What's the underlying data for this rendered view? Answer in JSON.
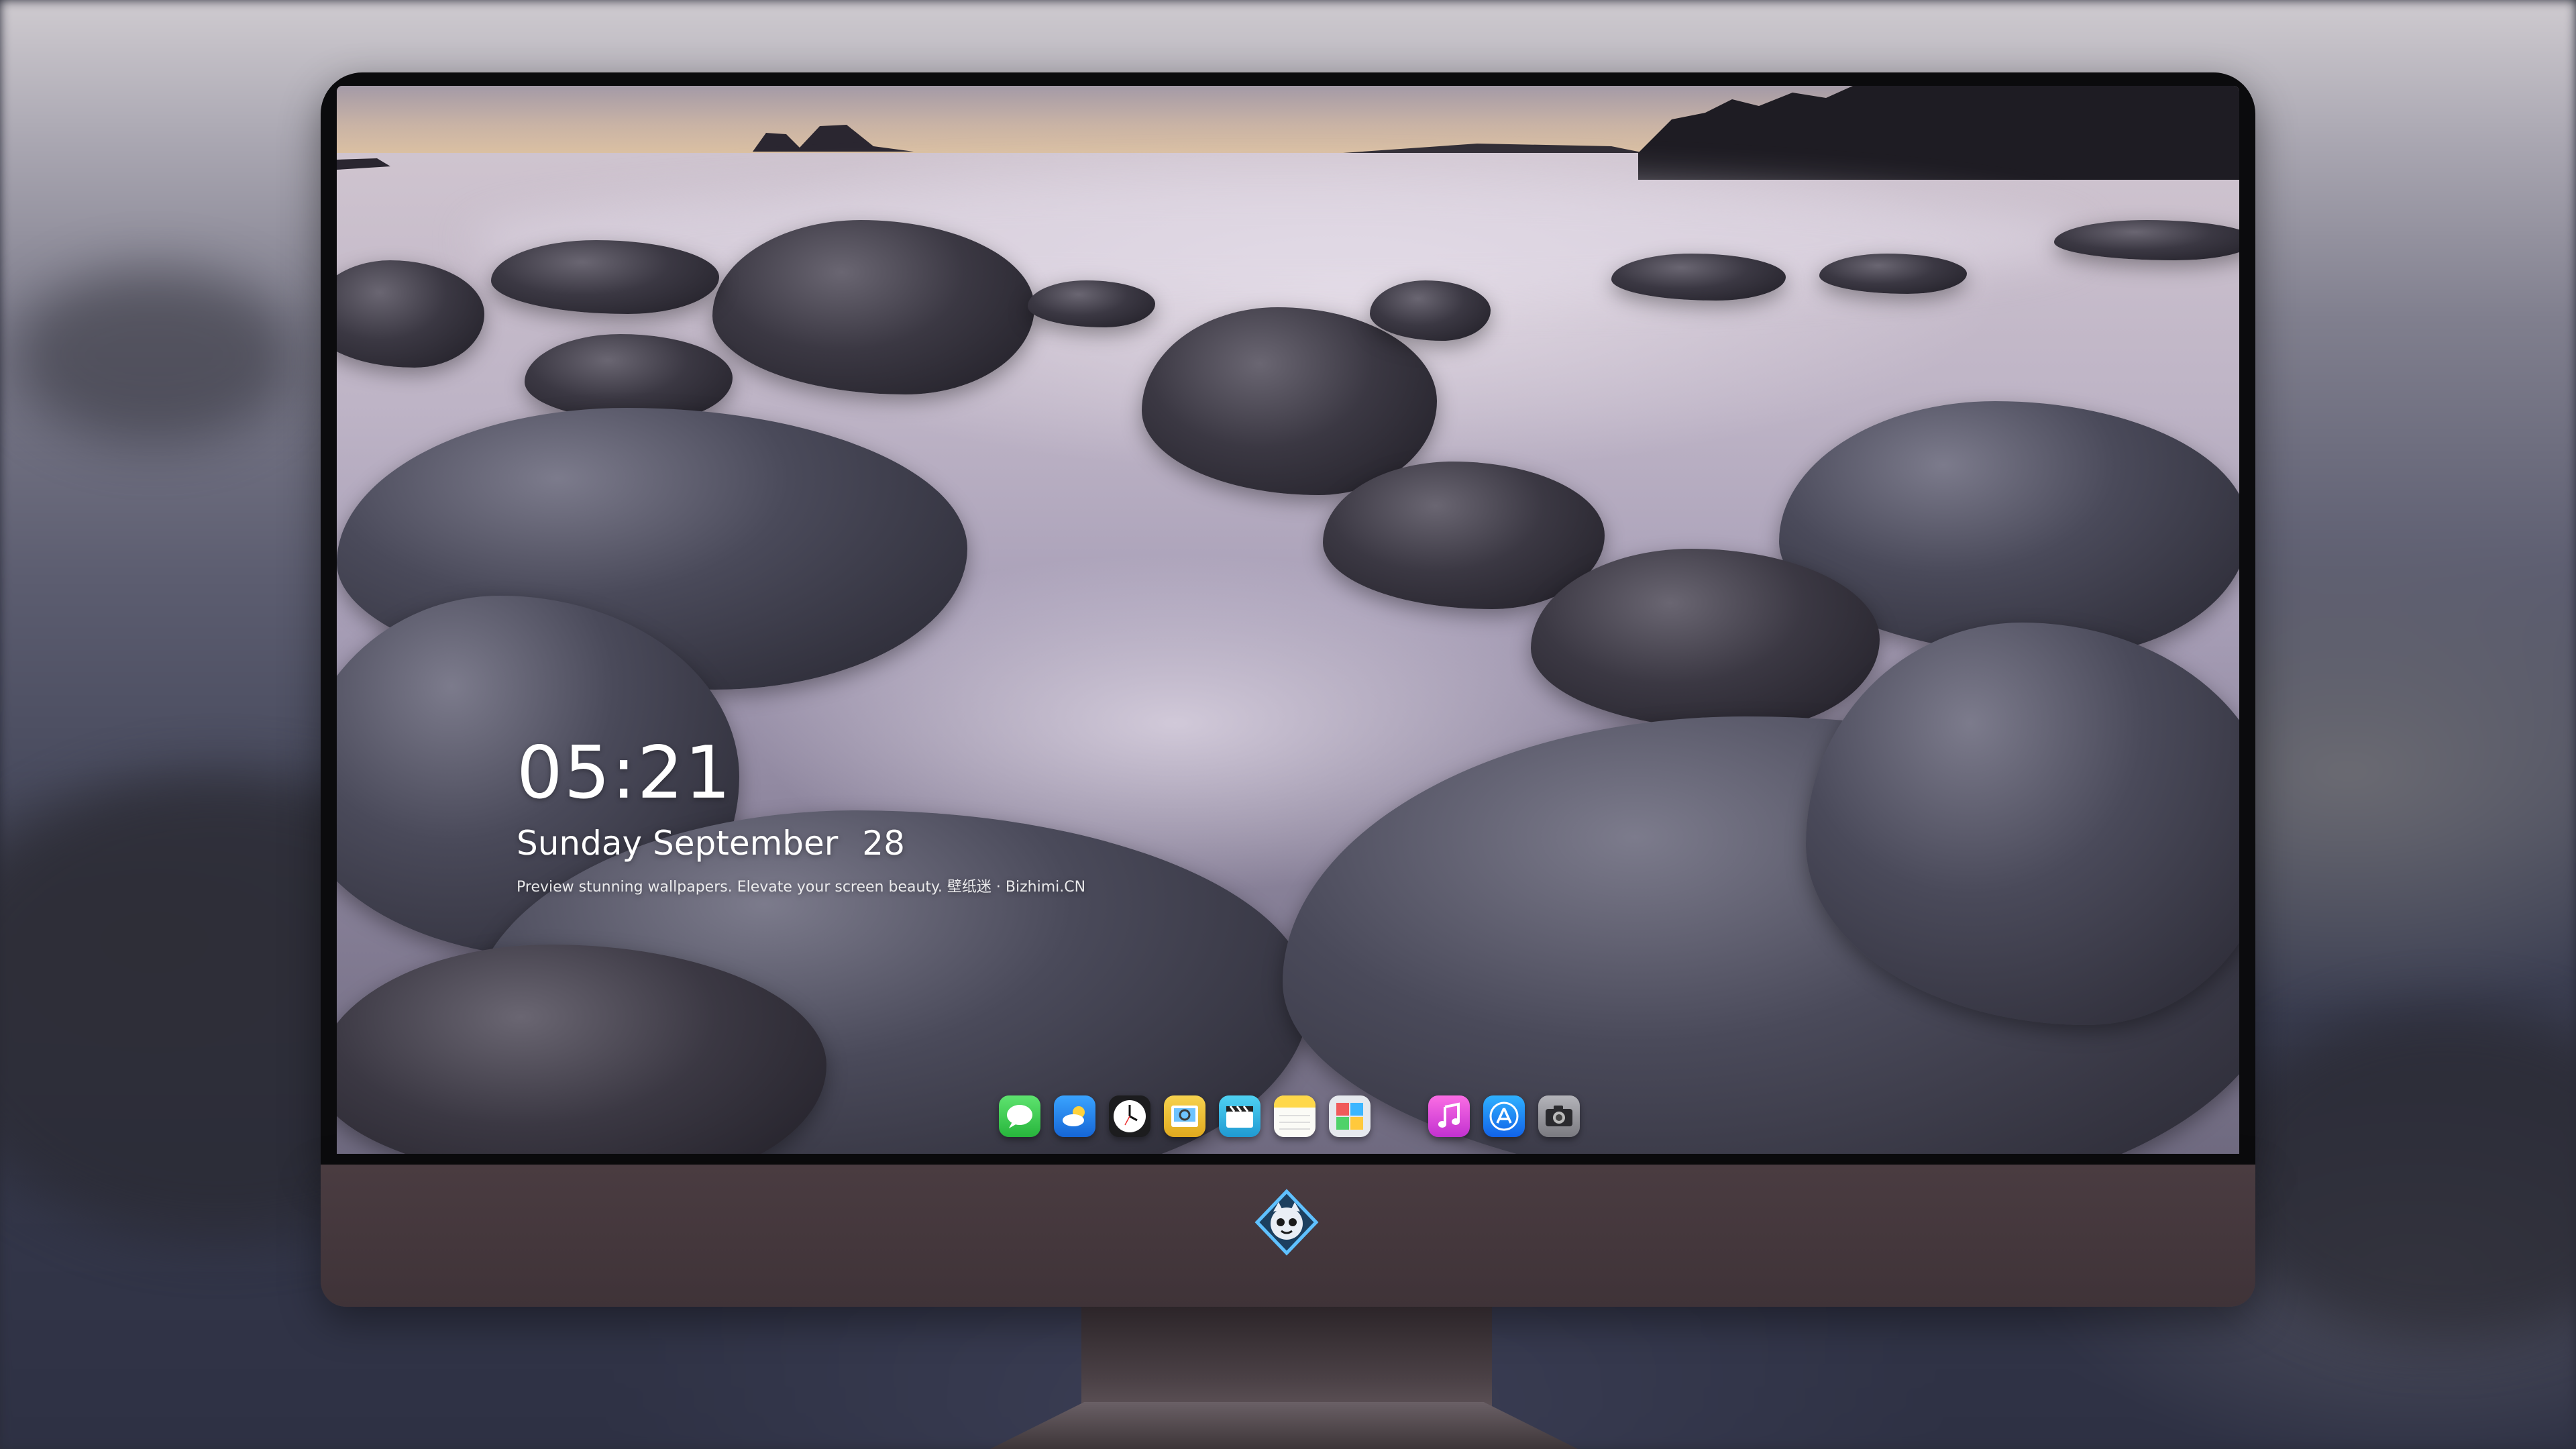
{
  "widget": {
    "time": "05:21",
    "weekday": "Sunday",
    "month": "September",
    "day": "28",
    "tagline": "Preview stunning wallpapers. Elevate your screen beauty. 壁纸迷 · Bizhimi.CN"
  },
  "dock": {
    "apps": [
      {
        "name": "Messages",
        "icon": "messages-icon",
        "color": "#34c759"
      },
      {
        "name": "Weather",
        "icon": "weather-icon",
        "color": "#2a8ff7"
      },
      {
        "name": "Clock",
        "icon": "clock-icon",
        "color": "#1c1c1e"
      },
      {
        "name": "Preview",
        "icon": "preview-icon",
        "color": "#f4c542"
      },
      {
        "name": "Clips",
        "icon": "clips-icon",
        "color": "#2ab7ea"
      },
      {
        "name": "Notes",
        "icon": "notes-icon",
        "color": "#ffd84a"
      },
      {
        "name": "Photo Booth",
        "icon": "photo-booth-icon",
        "color": "#e0e4ea"
      },
      {
        "name": "Music",
        "icon": "music-icon",
        "color": "#f34fd5"
      },
      {
        "name": "App Store",
        "icon": "app-store-icon",
        "color": "#1e8bff"
      },
      {
        "name": "Camera",
        "icon": "camera-icon",
        "color": "#9a9aa0"
      }
    ]
  },
  "colors": {
    "bezel": "#0b0b0d",
    "chin": "#4a3c41",
    "widget_text": "#ffffff"
  },
  "logo": "mascot-logo-icon"
}
